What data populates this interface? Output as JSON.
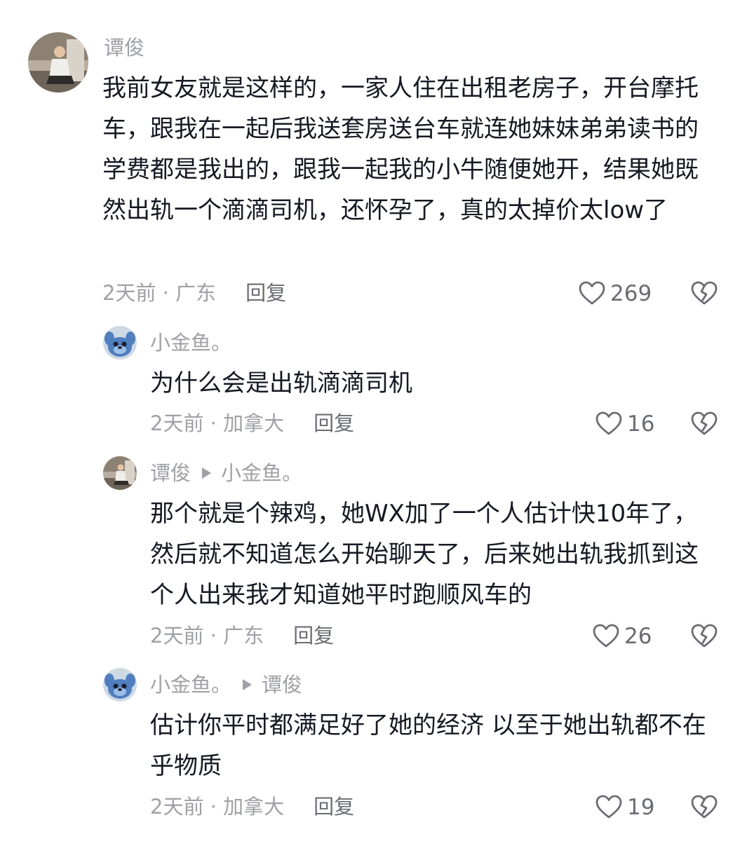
{
  "comments": [
    {
      "username": "谭俊",
      "reply_to": "",
      "text": "我前女友就是这样的，一家人住在出租老房子，开台摩托车，跟我在一起后我送套房送台车就连她妹妹弟弟读书的学费都是我出的，跟我一起我的小牛随便她开，结果她既然出轨一个滴滴司机，还怀孕了，真的太掉价太low了",
      "time_location": "2天前 · 广东",
      "reply_label": "回复",
      "likes": "269",
      "avatar": "person-photo"
    },
    {
      "username": "小金鱼。",
      "reply_to": "",
      "text": "为什么会是出轨滴滴司机",
      "time_location": "2天前 · 加拿大",
      "reply_label": "回复",
      "likes": "16",
      "avatar": "cartoon-blue-character"
    },
    {
      "username": "谭俊",
      "reply_to": "小金鱼。",
      "text": "那个就是个辣鸡，她WX加了一个人估计快10年了，然后就不知道怎么开始聊天了，后来她出轨我抓到这个人出来我才知道她平时跑顺风车的",
      "time_location": "2天前 · 广东",
      "reply_label": "回复",
      "likes": "26",
      "avatar": "person-photo"
    },
    {
      "username": "小金鱼。",
      "reply_to": "谭俊",
      "text": "估计你平时都满足好了她的经济 以至于她出轨都不在乎物质",
      "time_location": "2天前 · 加拿大",
      "reply_label": "回复",
      "likes": "19",
      "avatar": "cartoon-blue-character"
    }
  ],
  "icons": {
    "like": "heart-outline-icon",
    "dislike": "broken-heart-icon"
  },
  "colors": {
    "text_primary": "#161823",
    "text_secondary": "#a0a1a6",
    "reply_button": "#6b6c73"
  }
}
